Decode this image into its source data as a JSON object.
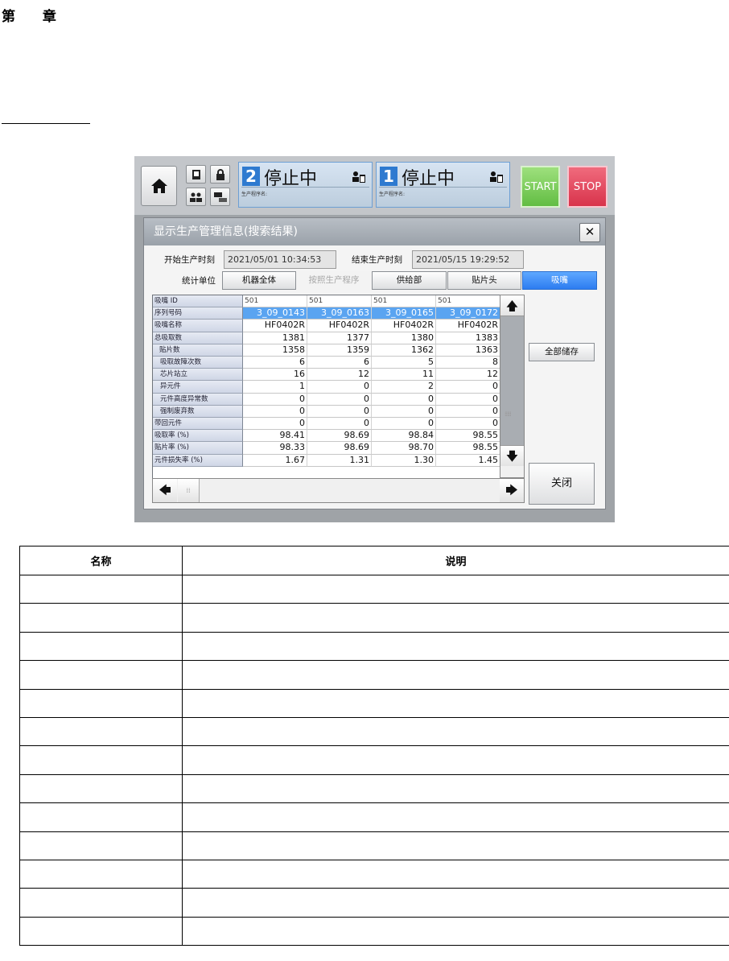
{
  "doc": {
    "chapter": "第 章"
  },
  "ui": {
    "header": {
      "lanes": [
        {
          "num": "2",
          "status": "停止中",
          "program_label": "生产程序名:"
        },
        {
          "num": "1",
          "status": "停止中",
          "program_label": "生产程序名:"
        }
      ],
      "start_label": "START",
      "stop_label": "STOP",
      "colors": {
        "start": "#6cc54b",
        "stop": "#dc3a52",
        "lane_number": "#2e7ad0",
        "selected": "#5aa4f1"
      }
    },
    "dialog": {
      "title": "显示生产管理信息(搜索结果)",
      "close_glyph": "✕",
      "start_time_label": "开始生产时刻",
      "start_time_value": "2021/05/01 10:34:53",
      "end_time_label": "结束生产时刻",
      "end_time_value": "2021/05/15 19:29:52",
      "unit_label": "统计单位",
      "units": [
        "机器全体",
        "按照生产程序",
        "供给部",
        "贴片头",
        "吸嘴"
      ],
      "selected_unit": "吸嘴",
      "save_all_label": "全部储存",
      "close_label": "关闭"
    },
    "grid": {
      "rows": [
        {
          "label": "吸嘴 ID",
          "values": [
            "501",
            "501",
            "501",
            "501"
          ]
        },
        {
          "label": "序列号码",
          "values": [
            "3_09_0143",
            "3_09_0163",
            "3_09_0165",
            "3_09_0172"
          ]
        },
        {
          "label": "吸嘴名称",
          "values": [
            "HF0402R",
            "HF0402R",
            "HF0402R",
            "HF0402R"
          ]
        },
        {
          "label": "总吸取数",
          "values": [
            "1381",
            "1377",
            "1380",
            "1383"
          ]
        },
        {
          "label": "贴片数",
          "values": [
            "1358",
            "1359",
            "1362",
            "1363"
          ]
        },
        {
          "label": "吸取故障次数",
          "values": [
            "6",
            "6",
            "5",
            "8"
          ]
        },
        {
          "label": "芯片站立",
          "values": [
            "16",
            "12",
            "11",
            "12"
          ]
        },
        {
          "label": "异元件",
          "values": [
            "1",
            "0",
            "2",
            "0"
          ]
        },
        {
          "label": "元件高度异常数",
          "values": [
            "0",
            "0",
            "0",
            "0"
          ]
        },
        {
          "label": "强制废弃数",
          "values": [
            "0",
            "0",
            "0",
            "0"
          ]
        },
        {
          "label": "带回元件",
          "values": [
            "0",
            "0",
            "0",
            "0"
          ]
        },
        {
          "label": "吸取率 (%)",
          "values": [
            "98.41",
            "98.69",
            "98.84",
            "98.55"
          ]
        },
        {
          "label": "贴片率 (%)",
          "values": [
            "98.33",
            "98.69",
            "98.70",
            "98.55"
          ]
        },
        {
          "label": "元件损失率 (%)",
          "values": [
            "1.67",
            "1.31",
            "1.30",
            "1.45"
          ]
        }
      ]
    }
  },
  "table": {
    "headers": {
      "name": "名称",
      "desc": "说明"
    },
    "rows": [
      {
        "name": "",
        "desc": ""
      },
      {
        "name": "",
        "desc": ""
      },
      {
        "name": "",
        "desc": ""
      },
      {
        "name": "",
        "desc": ""
      },
      {
        "name": "",
        "desc": ""
      },
      {
        "name": "",
        "desc": ""
      },
      {
        "name": "",
        "desc": ""
      },
      {
        "name": "",
        "desc": ""
      },
      {
        "name": "",
        "desc": ""
      },
      {
        "name": "",
        "desc": ""
      },
      {
        "name": "",
        "desc": ""
      },
      {
        "name": "",
        "desc": ""
      },
      {
        "name": "",
        "desc": ""
      }
    ]
  }
}
